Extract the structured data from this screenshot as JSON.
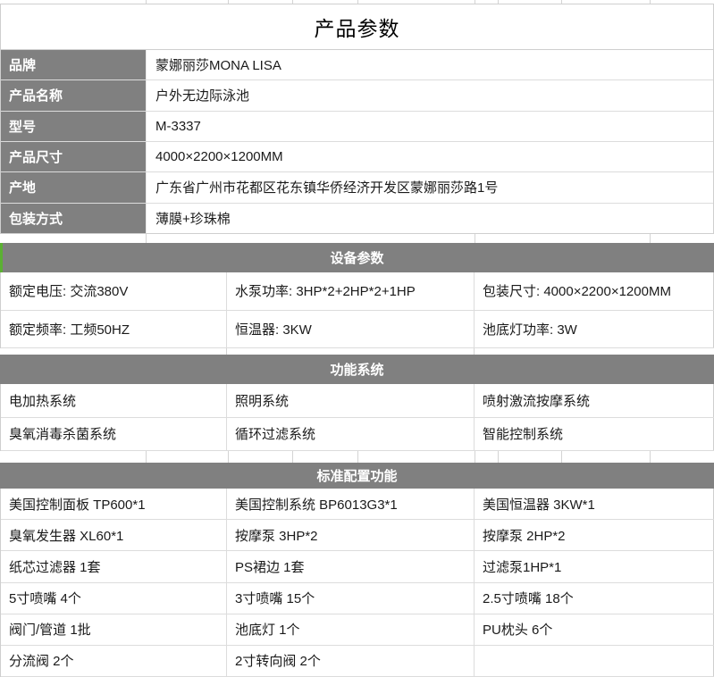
{
  "title": "产品参数",
  "info": {
    "rows": [
      {
        "label": "品牌",
        "value": "蒙娜丽莎MONA LISA"
      },
      {
        "label": "产品名称",
        "value": "户外无边际泳池"
      },
      {
        "label": "型号",
        "value": "M-3337"
      },
      {
        "label": "产品尺寸",
        "value": "4000×2200×1200MM"
      },
      {
        "label": "产地",
        "value": "广东省广州市花都区花东镇华侨经济开发区蒙娜丽莎路1号"
      },
      {
        "label": "包装方式",
        "value": "薄膜+珍珠棉"
      }
    ]
  },
  "sections": [
    {
      "header": "设备参数",
      "rows": [
        [
          "额定电压: 交流380V",
          "水泵功率: 3HP*2+2HP*2+1HP",
          "包装尺寸: 4000×2200×1200MM"
        ],
        [
          "额定频率: 工频50HZ",
          "恒温器: 3KW",
          "池底灯功率: 3W"
        ]
      ]
    },
    {
      "header": "功能系统",
      "rows": [
        [
          "电加热系统",
          "照明系统",
          "喷射激流按摩系统"
        ],
        [
          "臭氧消毒杀菌系统",
          "循环过滤系统",
          "智能控制系统"
        ]
      ]
    },
    {
      "header": "标准配置功能",
      "rows": [
        [
          "美国控制面板 TP600*1",
          "美国控制系统 BP6013G3*1",
          "美国恒温器 3KW*1"
        ],
        [
          "臭氧发生器 XL60*1",
          "按摩泵 3HP*2",
          "按摩泵 2HP*2"
        ],
        [
          "纸芯过滤器 1套",
          "PS裙边 1套",
          "过滤泵1HP*1"
        ],
        [
          "5寸喷嘴 4个",
          "3寸喷嘴 15个",
          "2.5寸喷嘴 18个"
        ],
        [
          "阀门/管道 1批",
          "池底灯 1个",
          "PU枕头 6个"
        ],
        [
          "分流阀 2个",
          "2寸转向阀 2个",
          ""
        ]
      ]
    }
  ],
  "colors": {
    "header_gray": "#808080",
    "accent_green": "#5bb033",
    "gridline": "#d4d4d4",
    "text": "#1a1a1a"
  }
}
